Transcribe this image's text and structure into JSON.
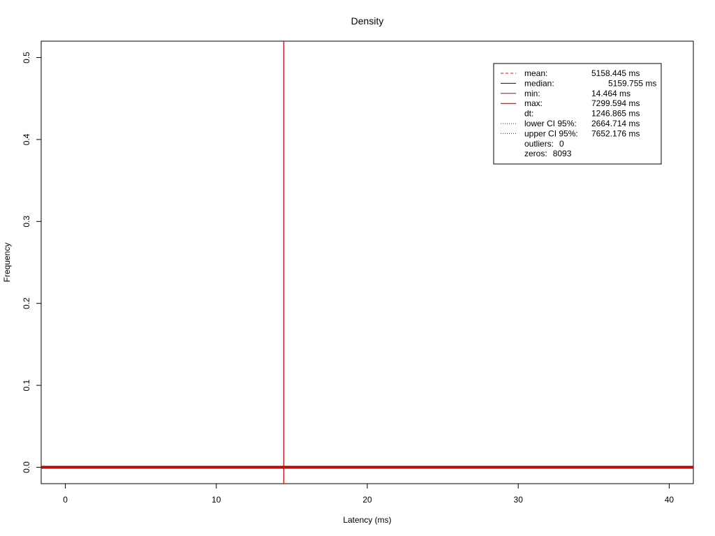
{
  "chart_data": {
    "type": "line",
    "title": "Density",
    "xlabel": "Latency (ms)",
    "ylabel": "Frequency",
    "xlim": [
      -1.6,
      41.6
    ],
    "ylim": [
      -0.02,
      0.52
    ],
    "x_ticks": [
      0,
      10,
      20,
      30,
      40
    ],
    "y_ticks": [
      0.0,
      0.1,
      0.2,
      0.3,
      0.4,
      0.5
    ],
    "grid": false,
    "legend_position": "top-right",
    "series": [
      {
        "x": [
          -1.6,
          41.6
        ],
        "y": [
          0,
          0
        ],
        "color": "#000000",
        "style": "solid"
      }
    ],
    "reference_lines": [
      {
        "stat": "mean",
        "value": 5158.445,
        "color": "#ff0000",
        "style": "dashed"
      },
      {
        "stat": "median",
        "value": 5159.755,
        "color": "#000080",
        "style": "solid"
      },
      {
        "stat": "min",
        "value": 14.464,
        "color": "#cc0000",
        "style": "solid"
      },
      {
        "stat": "max",
        "value": 7299.594,
        "color": "#8b0000",
        "style": "solid"
      },
      {
        "stat": "lower CI 95%",
        "value": 2664.714,
        "color": "#006400",
        "style": "dotted"
      },
      {
        "stat": "upper CI 95%",
        "value": 7652.176,
        "color": "#006400",
        "style": "dotted"
      }
    ],
    "legend": [
      {
        "label": "mean:",
        "value": "5158.445 ms",
        "line": {
          "color": "#ff0000",
          "dash": "4,3"
        }
      },
      {
        "label": "median:",
        "value": "5159.755 ms",
        "line": {
          "color": "#000080",
          "dash": ""
        },
        "indent": true
      },
      {
        "label": "min:",
        "value": "14.464 ms",
        "line": {
          "color": "#cc0000",
          "dash": ""
        }
      },
      {
        "label": "max:",
        "value": "7299.594 ms",
        "line": {
          "color": "#8b0000",
          "dash": ""
        }
      },
      {
        "label": "dt:",
        "value": "1246.865 ms",
        "line": null
      },
      {
        "label": "lower CI 95%:",
        "value": "2664.714 ms",
        "line": {
          "color": "#006400",
          "dash": "1,2"
        }
      },
      {
        "label": "upper CI 95%:",
        "value": "7652.176 ms",
        "line": {
          "color": "#006400",
          "dash": "1,2"
        }
      },
      {
        "label": "outliers:",
        "value": "0",
        "line": null,
        "inline": true
      },
      {
        "label": "zeros:",
        "value": "8093",
        "line": null,
        "inline": true
      }
    ]
  }
}
